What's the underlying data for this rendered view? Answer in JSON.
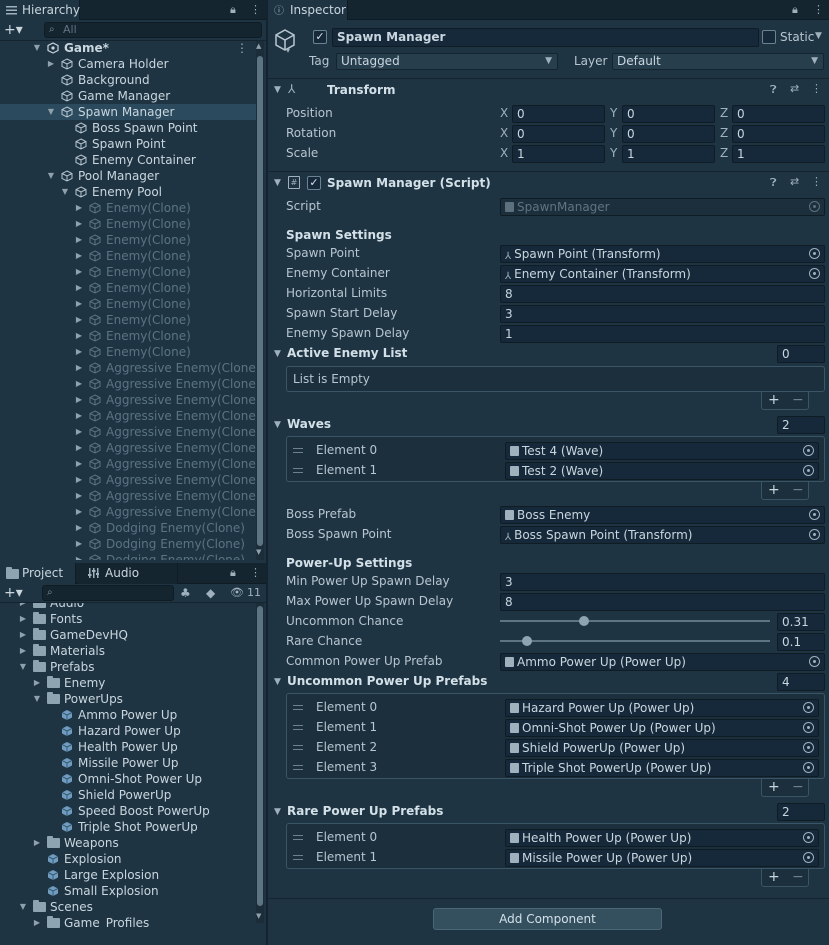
{
  "hierarchy": {
    "tab_label": "Hierarchy",
    "search_placeholder": "All",
    "rows": [
      {
        "label": "Game*",
        "indent": 1,
        "arrow": "down",
        "icon": "unity-scene-icon",
        "bold": true,
        "dim": false,
        "sel": false
      },
      {
        "label": "Camera Holder",
        "indent": 2,
        "arrow": "right",
        "icon": "gameobject-icon",
        "dim": false
      },
      {
        "label": "Background",
        "indent": 2,
        "arrow": "",
        "icon": "gameobject-icon",
        "dim": false
      },
      {
        "label": "Game Manager",
        "indent": 2,
        "arrow": "",
        "icon": "gameobject-icon",
        "dim": false
      },
      {
        "label": "Spawn Manager",
        "indent": 2,
        "arrow": "down",
        "icon": "gameobject-icon",
        "dim": false,
        "sel": true
      },
      {
        "label": "Boss Spawn Point",
        "indent": 3,
        "arrow": "",
        "icon": "gameobject-icon",
        "dim": false
      },
      {
        "label": "Spawn Point",
        "indent": 3,
        "arrow": "",
        "icon": "gameobject-icon",
        "dim": false
      },
      {
        "label": "Enemy Container",
        "indent": 3,
        "arrow": "",
        "icon": "gameobject-icon",
        "dim": false
      },
      {
        "label": "Pool Manager",
        "indent": 2,
        "arrow": "down",
        "icon": "gameobject-icon",
        "dim": false
      },
      {
        "label": "Enemy Pool",
        "indent": 3,
        "arrow": "down",
        "icon": "gameobject-icon",
        "dim": false
      },
      {
        "label": "Enemy(Clone)",
        "indent": 4,
        "arrow": "right",
        "icon": "gameobject-icon",
        "dim": true
      },
      {
        "label": "Enemy(Clone)",
        "indent": 4,
        "arrow": "right",
        "icon": "gameobject-icon",
        "dim": true
      },
      {
        "label": "Enemy(Clone)",
        "indent": 4,
        "arrow": "right",
        "icon": "gameobject-icon",
        "dim": true
      },
      {
        "label": "Enemy(Clone)",
        "indent": 4,
        "arrow": "right",
        "icon": "gameobject-icon",
        "dim": true
      },
      {
        "label": "Enemy(Clone)",
        "indent": 4,
        "arrow": "right",
        "icon": "gameobject-icon",
        "dim": true
      },
      {
        "label": "Enemy(Clone)",
        "indent": 4,
        "arrow": "right",
        "icon": "gameobject-icon",
        "dim": true
      },
      {
        "label": "Enemy(Clone)",
        "indent": 4,
        "arrow": "right",
        "icon": "gameobject-icon",
        "dim": true
      },
      {
        "label": "Enemy(Clone)",
        "indent": 4,
        "arrow": "right",
        "icon": "gameobject-icon",
        "dim": true
      },
      {
        "label": "Enemy(Clone)",
        "indent": 4,
        "arrow": "right",
        "icon": "gameobject-icon",
        "dim": true
      },
      {
        "label": "Enemy(Clone)",
        "indent": 4,
        "arrow": "right",
        "icon": "gameobject-icon",
        "dim": true
      },
      {
        "label": "Aggressive Enemy(Clone)",
        "indent": 4,
        "arrow": "right",
        "icon": "gameobject-icon",
        "dim": true
      },
      {
        "label": "Aggressive Enemy(Clone)",
        "indent": 4,
        "arrow": "right",
        "icon": "gameobject-icon",
        "dim": true
      },
      {
        "label": "Aggressive Enemy(Clone)",
        "indent": 4,
        "arrow": "right",
        "icon": "gameobject-icon",
        "dim": true
      },
      {
        "label": "Aggressive Enemy(Clone)",
        "indent": 4,
        "arrow": "right",
        "icon": "gameobject-icon",
        "dim": true
      },
      {
        "label": "Aggressive Enemy(Clone)",
        "indent": 4,
        "arrow": "right",
        "icon": "gameobject-icon",
        "dim": true
      },
      {
        "label": "Aggressive Enemy(Clone)",
        "indent": 4,
        "arrow": "right",
        "icon": "gameobject-icon",
        "dim": true
      },
      {
        "label": "Aggressive Enemy(Clone)",
        "indent": 4,
        "arrow": "right",
        "icon": "gameobject-icon",
        "dim": true
      },
      {
        "label": "Aggressive Enemy(Clone)",
        "indent": 4,
        "arrow": "right",
        "icon": "gameobject-icon",
        "dim": true
      },
      {
        "label": "Aggressive Enemy(Clone)",
        "indent": 4,
        "arrow": "right",
        "icon": "gameobject-icon",
        "dim": true
      },
      {
        "label": "Aggressive Enemy(Clone)",
        "indent": 4,
        "arrow": "right",
        "icon": "gameobject-icon",
        "dim": true
      },
      {
        "label": "Dodging Enemy(Clone)",
        "indent": 4,
        "arrow": "right",
        "icon": "gameobject-icon",
        "dim": true
      },
      {
        "label": "Dodging Enemy(Clone)",
        "indent": 4,
        "arrow": "right",
        "icon": "gameobject-icon",
        "dim": true
      },
      {
        "label": "Dodging Enemy(Clone)",
        "indent": 4,
        "arrow": "right",
        "icon": "gameobject-icon",
        "dim": true
      }
    ]
  },
  "project": {
    "tab_label": "Project",
    "tab2_label": "Audio Mixer",
    "hidden_count": "11",
    "rows": [
      {
        "label": "Audio",
        "indent": 1,
        "arrow": "right",
        "icon": "folder"
      },
      {
        "label": "Fonts",
        "indent": 1,
        "arrow": "right",
        "icon": "folder"
      },
      {
        "label": "GameDevHQ",
        "indent": 1,
        "arrow": "right",
        "icon": "folder"
      },
      {
        "label": "Materials",
        "indent": 1,
        "arrow": "right",
        "icon": "folder"
      },
      {
        "label": "Prefabs",
        "indent": 1,
        "arrow": "down",
        "icon": "folder"
      },
      {
        "label": "Enemy",
        "indent": 2,
        "arrow": "right",
        "icon": "folder"
      },
      {
        "label": "PowerUps",
        "indent": 2,
        "arrow": "down",
        "icon": "folder"
      },
      {
        "label": "Ammo Power Up",
        "indent": 3,
        "arrow": "",
        "icon": "prefab"
      },
      {
        "label": "Hazard Power Up",
        "indent": 3,
        "arrow": "",
        "icon": "prefab"
      },
      {
        "label": "Health Power Up",
        "indent": 3,
        "arrow": "",
        "icon": "prefab"
      },
      {
        "label": "Missile Power Up",
        "indent": 3,
        "arrow": "",
        "icon": "prefab"
      },
      {
        "label": "Omni-Shot Power Up",
        "indent": 3,
        "arrow": "",
        "icon": "prefab"
      },
      {
        "label": "Shield PowerUp",
        "indent": 3,
        "arrow": "",
        "icon": "prefab"
      },
      {
        "label": "Speed Boost PowerUp",
        "indent": 3,
        "arrow": "",
        "icon": "prefab"
      },
      {
        "label": "Triple Shot PowerUp",
        "indent": 3,
        "arrow": "",
        "icon": "prefab"
      },
      {
        "label": "Weapons",
        "indent": 2,
        "arrow": "right",
        "icon": "folder"
      },
      {
        "label": "Explosion",
        "indent": 2,
        "arrow": "",
        "icon": "prefab"
      },
      {
        "label": "Large Explosion",
        "indent": 2,
        "arrow": "",
        "icon": "prefab"
      },
      {
        "label": "Small Explosion",
        "indent": 2,
        "arrow": "",
        "icon": "prefab"
      },
      {
        "label": "Scenes",
        "indent": 1,
        "arrow": "down",
        "icon": "folder"
      },
      {
        "label": "Game_Profiles",
        "indent": 2,
        "arrow": "right",
        "icon": "folder"
      }
    ]
  },
  "inspector": {
    "tab_label": "Inspector",
    "object_name": "Spawn Manager",
    "static_label": "Static",
    "tag_label": "Tag",
    "tag_value": "Untagged",
    "layer_label": "Layer",
    "layer_value": "Default",
    "transform": {
      "title": "Transform",
      "position_label": "Position",
      "rotation_label": "Rotation",
      "scale_label": "Scale",
      "axis_x": "X",
      "axis_y": "Y",
      "axis_z": "Z",
      "position": [
        "0",
        "0",
        "0"
      ],
      "rotation": [
        "0",
        "0",
        "0"
      ],
      "scale": [
        "1",
        "1",
        "1"
      ]
    },
    "script": {
      "title": "Spawn Manager (Script)",
      "script_label": "Script",
      "script_value": "SpawnManager",
      "spawn_settings": "Spawn Settings",
      "spawn_point_label": "Spawn Point",
      "spawn_point_value": "Spawn Point (Transform)",
      "enemy_container_label": "Enemy Container",
      "enemy_container_value": "Enemy Container (Transform)",
      "horizontal_limits_label": "Horizontal Limits",
      "horizontal_limits_value": "8",
      "spawn_start_delay_label": "Spawn Start Delay",
      "spawn_start_delay_value": "3",
      "enemy_spawn_delay_label": "Enemy Spawn Delay",
      "enemy_spawn_delay_value": "1",
      "active_enemy_list_label": "Active Enemy List",
      "active_enemy_list_count": "0",
      "list_empty": "List is Empty",
      "waves_label": "Waves",
      "waves_count": "2",
      "waves": [
        {
          "label": "Element 0",
          "value": "Test 4 (Wave)"
        },
        {
          "label": "Element 1",
          "value": "Test 2 (Wave)"
        }
      ],
      "boss_prefab_label": "Boss Prefab",
      "boss_prefab_value": "Boss Enemy",
      "boss_spawn_point_label": "Boss Spawn Point",
      "boss_spawn_point_value": "Boss Spawn Point (Transform)",
      "powerup_settings": "Power-Up Settings",
      "min_delay_label": "Min Power Up Spawn Delay",
      "min_delay_value": "3",
      "max_delay_label": "Max Power Up Spawn Delay",
      "max_delay_value": "8",
      "uncommon_chance_label": "Uncommon Chance",
      "uncommon_chance_value": "0.31",
      "uncommon_chance_fraction": 0.31,
      "rare_chance_label": "Rare Chance",
      "rare_chance_value": "0.1",
      "rare_chance_fraction": 0.1,
      "common_prefab_label": "Common Power Up Prefab",
      "common_prefab_value": "Ammo Power Up (Power Up)",
      "uncommon_prefabs_label": "Uncommon Power Up Prefabs",
      "uncommon_prefabs_count": "4",
      "uncommon_prefabs": [
        {
          "label": "Element 0",
          "value": "Hazard Power Up (Power Up)"
        },
        {
          "label": "Element 1",
          "value": "Omni-Shot Power Up (Power Up)"
        },
        {
          "label": "Element 2",
          "value": "Shield PowerUp (Power Up)"
        },
        {
          "label": "Element 3",
          "value": "Triple Shot PowerUp (Power Up)"
        }
      ],
      "rare_prefabs_label": "Rare Power Up Prefabs",
      "rare_prefabs_count": "2",
      "rare_prefabs": [
        {
          "label": "Element 0",
          "value": "Health Power Up (Power Up)"
        },
        {
          "label": "Element 1",
          "value": "Missile Power Up (Power Up)"
        }
      ]
    },
    "add_component": "Add Component"
  },
  "colors": {
    "background": "#1f3442",
    "selected_row": "#2b4a5e",
    "field": "#16293a"
  }
}
